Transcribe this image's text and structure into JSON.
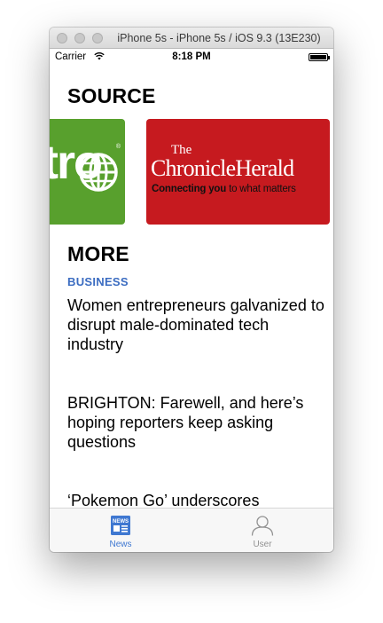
{
  "window": {
    "title": "iPhone 5s - iPhone 5s / iOS 9.3 (13E230)"
  },
  "status_bar": {
    "carrier": "Carrier",
    "time": "8:18 PM",
    "wifi_icon": "wifi-icon",
    "battery_icon": "battery-icon"
  },
  "sections": {
    "source_title": "SOURCE",
    "more_title": "MORE"
  },
  "sources": [
    {
      "name_fragment": "tro",
      "icon": "globe-icon",
      "color": "#58a02d"
    },
    {
      "the": "The",
      "name": "ChronicleHerald",
      "tagline_bold": "Connecting you",
      "tagline_rest": " to what matters",
      "color": "#c61a1f"
    }
  ],
  "more": {
    "category": "BUSINESS",
    "category_color": "#3b6cc1",
    "articles": [
      {
        "title": "Women entrepreneurs galvanized to disrupt male-dominated tech industry"
      },
      {
        "title": "BRIGHTON: Farewell, and here’s hoping reporters keep asking questions"
      },
      {
        "title": "‘Pokemon Go’ underscores"
      }
    ]
  },
  "tab_bar": {
    "tabs": [
      {
        "label": "News",
        "icon": "news-icon",
        "selected": true,
        "color": "#3f78d1"
      },
      {
        "label": "User",
        "icon": "user-icon",
        "selected": false,
        "color": "#929292"
      }
    ]
  }
}
